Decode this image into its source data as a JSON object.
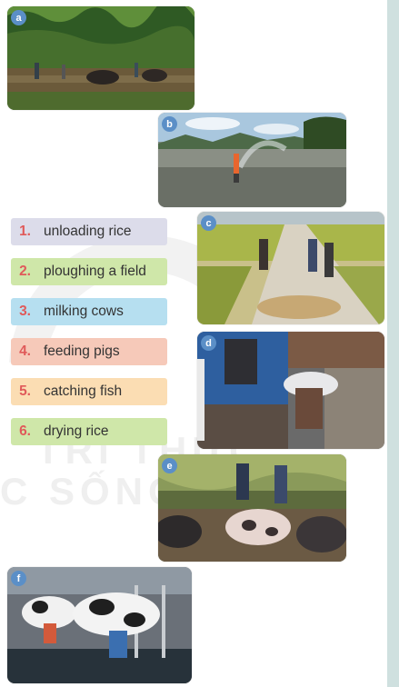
{
  "badge_color": "#5b8fc7",
  "photos": [
    {
      "badge": "a",
      "subject": "ploughing a field with buffaloes"
    },
    {
      "badge": "b",
      "subject": "fisherman casting a net"
    },
    {
      "badge": "c",
      "subject": "farmers drying rice on a road"
    },
    {
      "badge": "d",
      "subject": "man unloading a sack of rice from a truck"
    },
    {
      "badge": "e",
      "subject": "farmers feeding pigs"
    },
    {
      "badge": "f",
      "subject": "workers milking cows"
    }
  ],
  "phrases": [
    {
      "num": "1.",
      "text": "unloading rice",
      "bg": "#dcdcea",
      "num_color": "#e05a5a"
    },
    {
      "num": "2.",
      "text": "ploughing a field",
      "bg": "#cfe7a9",
      "num_color": "#e05a5a"
    },
    {
      "num": "3.",
      "text": "milking cows",
      "bg": "#b6dff0",
      "num_color": "#e05a5a"
    },
    {
      "num": "4.",
      "text": "feeding pigs",
      "bg": "#f6c9b9",
      "num_color": "#e05a5a"
    },
    {
      "num": "5.",
      "text": "catching fish",
      "bg": "#fbddb3",
      "num_color": "#e05a5a"
    },
    {
      "num": "6.",
      "text": "drying rice",
      "bg": "#cfe7a9",
      "num_color": "#e05a5a"
    }
  ]
}
